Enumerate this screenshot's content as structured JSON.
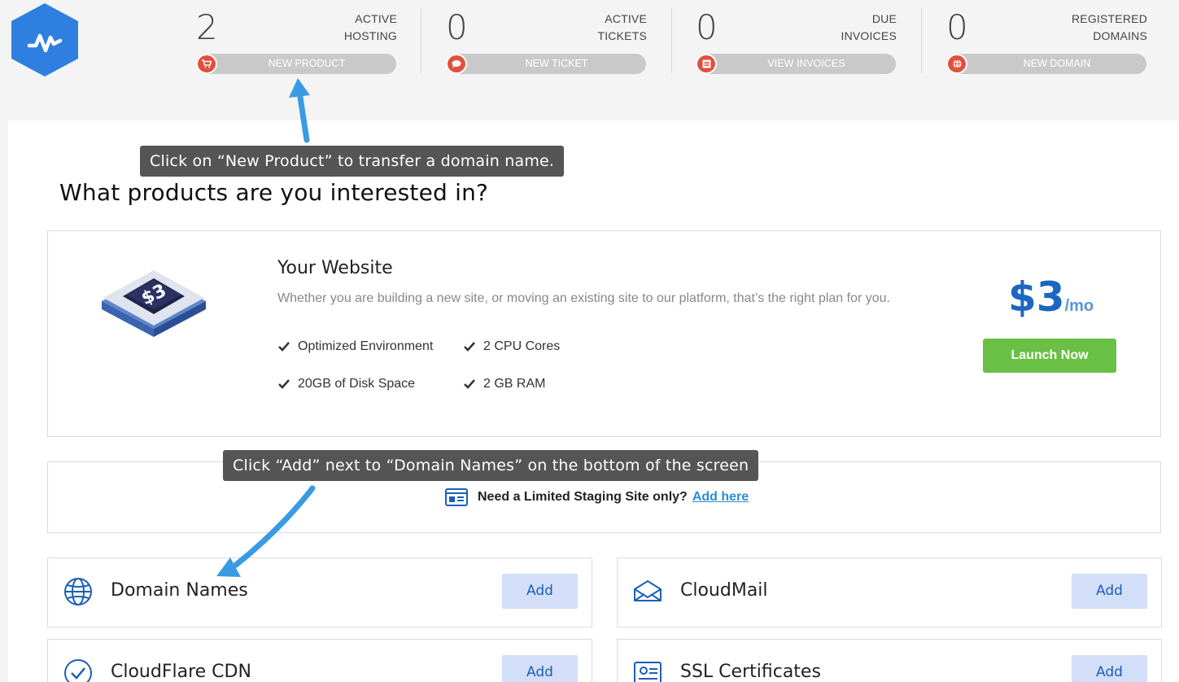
{
  "header": {
    "stats": [
      {
        "count": "2",
        "label_line1": "ACTIVE",
        "label_line2": "HOSTING",
        "button": "NEW PRODUCT",
        "icon": "cart-icon"
      },
      {
        "count": "0",
        "label_line1": "ACTIVE",
        "label_line2": "TICKETS",
        "button": "NEW TICKET",
        "icon": "chat-icon"
      },
      {
        "count": "0",
        "label_line1": "DUE",
        "label_line2": "INVOICES",
        "button": "VIEW INVOICES",
        "icon": "list-icon"
      },
      {
        "count": "0",
        "label_line1": "REGISTERED",
        "label_line2": "DOMAINS",
        "button": "NEW DOMAIN",
        "icon": "globe-icon"
      }
    ]
  },
  "annotations": {
    "top": "Click on “New Product” to transfer a domain name.",
    "bottom": "Click “Add” next to “Domain Names” on the bottom of the screen"
  },
  "main": {
    "title": "What products are you interested in?",
    "website": {
      "title": "Your Website",
      "description": "Whether you are building a new site, or moving an existing site to our platform, that’s the right plan for you.",
      "features": [
        "Optimized Environment",
        "2 CPU Cores",
        "20GB of Disk Space",
        "2 GB RAM"
      ],
      "price": "$3",
      "price_period": "/mo",
      "launch_label": "Launch Now"
    },
    "staging": {
      "text": "Need a Limited Staging Site only?",
      "link": "Add here"
    },
    "products": [
      {
        "name": "Domain Names",
        "add": "Add",
        "icon": "globe-icon"
      },
      {
        "name": "CloudMail",
        "add": "Add",
        "icon": "mail-icon"
      },
      {
        "name": "CloudFlare CDN",
        "add": "Add",
        "icon": "check-shield-icon"
      },
      {
        "name": "SSL Certificates",
        "add": "Add",
        "icon": "certificate-icon"
      }
    ]
  },
  "colors": {
    "accent_blue": "#1b67c1",
    "launch_green": "#6ac045",
    "stat_icon_red": "#e0503c",
    "annotation_arrow": "#3a9be3"
  }
}
